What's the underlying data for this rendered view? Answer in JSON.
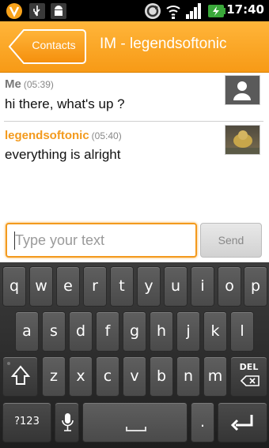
{
  "status_bar": {
    "time": "17:40",
    "icons": [
      "vlingo-icon",
      "usb-icon",
      "android-debug-icon",
      "sync-icon",
      "wifi-icon",
      "signal-icon",
      "battery-icon"
    ]
  },
  "header": {
    "back_label": "Contacts",
    "title": "IM - legendsoftonic"
  },
  "messages": [
    {
      "sender": "Me",
      "time": "(05:39)",
      "text": "hi there, what's up ?"
    },
    {
      "sender": "legendsoftonic",
      "time": "(05:40)",
      "text": "everything is alright"
    }
  ],
  "compose": {
    "placeholder": "Type your text",
    "send_label": "Send"
  },
  "keyboard": {
    "row1": [
      "q",
      "w",
      "e",
      "r",
      "t",
      "y",
      "u",
      "i",
      "o",
      "p"
    ],
    "row2": [
      "a",
      "s",
      "d",
      "f",
      "g",
      "h",
      "j",
      "k",
      "l"
    ],
    "row3": [
      "z",
      "x",
      "c",
      "v",
      "b",
      "n",
      "m"
    ],
    "del_label": "DEL",
    "symbols_label": "?123",
    "period_label": "."
  },
  "colors": {
    "accent": "#f79a16",
    "sender_other": "#f39a1d",
    "sender_me": "#777777"
  }
}
